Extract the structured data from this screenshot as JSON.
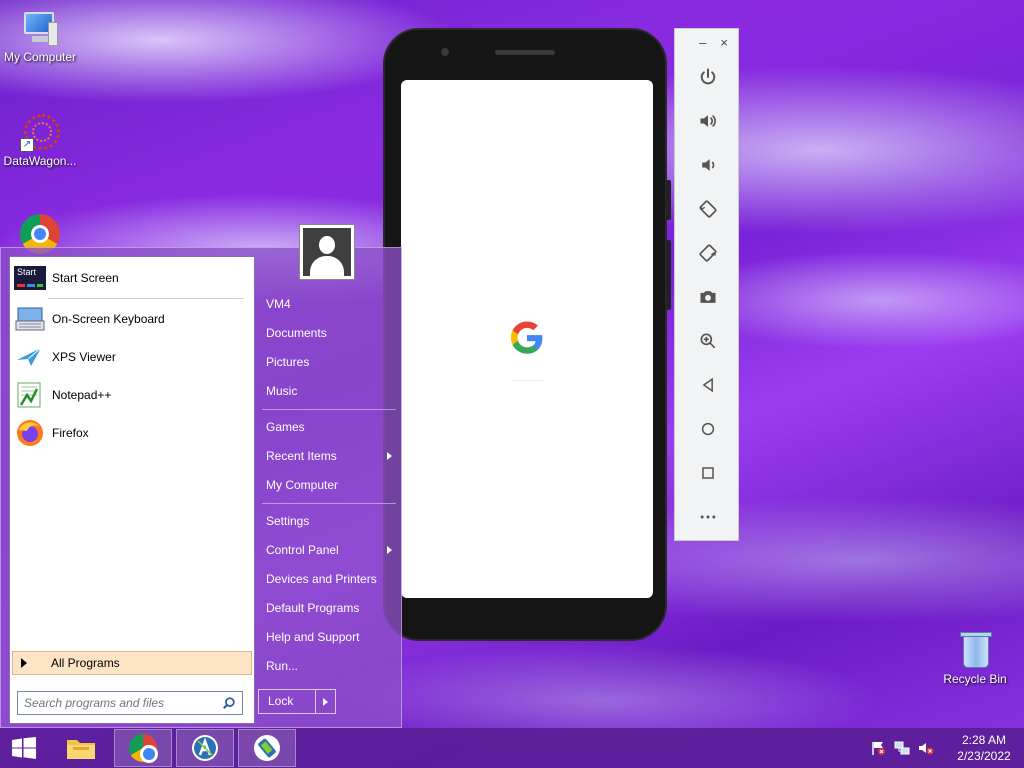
{
  "desktop": {
    "icons": [
      {
        "label": "My Computer"
      },
      {
        "label": "DataWagon..."
      },
      {
        "label": ""
      },
      {
        "label": "Recycle Bin"
      }
    ]
  },
  "emulator": {
    "screen_logo": "G",
    "toolbar": {
      "minimize": "–",
      "close": "×",
      "buttons": [
        "power-icon",
        "volume-up-icon",
        "volume-down-icon",
        "rotate-left-icon",
        "rotate-right-icon",
        "camera-icon",
        "zoom-icon",
        "back-icon",
        "home-icon",
        "overview-icon",
        "more-icon"
      ]
    }
  },
  "start_menu": {
    "programs": [
      {
        "label": "Start Screen"
      },
      {
        "label": "On-Screen Keyboard"
      },
      {
        "label": "XPS Viewer"
      },
      {
        "label": "Notepad++"
      },
      {
        "label": "Firefox"
      }
    ],
    "start_screen_icon_text": "Start",
    "all_programs": "All Programs",
    "search_placeholder": "Search programs and files",
    "right_items": [
      {
        "label": "VM4"
      },
      {
        "label": "Documents"
      },
      {
        "label": "Pictures"
      },
      {
        "label": "Music"
      },
      {
        "label": "Games"
      },
      {
        "label": "Recent Items"
      },
      {
        "label": "My Computer"
      },
      {
        "label": "Settings"
      },
      {
        "label": "Control Panel"
      },
      {
        "label": "Devices and Printers"
      },
      {
        "label": "Default Programs"
      },
      {
        "label": "Help and Support"
      },
      {
        "label": "Run..."
      }
    ],
    "lock_label": "Lock"
  },
  "taskbar": {
    "clock_time": "2:28 AM",
    "clock_date": "2/23/2022"
  },
  "colors": {
    "taskbar": "#5a1e96",
    "start_menu": "#8c50c8",
    "all_programs_highlight": "#fde4c4"
  }
}
